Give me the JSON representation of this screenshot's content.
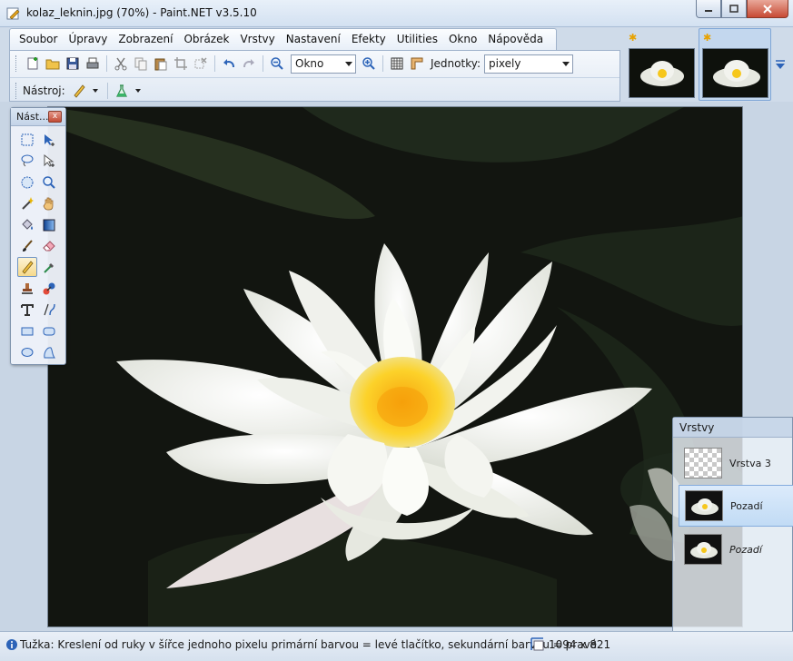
{
  "window": {
    "title": "kolaz_leknin.jpg (70%) - Paint.NET v3.5.10"
  },
  "menu": {
    "items": [
      "Soubor",
      "Úpravy",
      "Zobrazení",
      "Obrázek",
      "Vrstvy",
      "Nastavení",
      "Efekty",
      "Utilities",
      "Okno",
      "Nápověda"
    ]
  },
  "toolbar": {
    "zoom_value": "Okno",
    "units_label": "Jednotky:",
    "units_value": "pixely",
    "tool_label": "Nástroj:"
  },
  "tools_panel": {
    "title": "Nást...",
    "close_glyph": "x"
  },
  "layers_panel": {
    "title": "Vrstvy",
    "layers": [
      {
        "name": "Vrstva 3"
      },
      {
        "name": "Pozadí"
      },
      {
        "name": "Pozadí"
      }
    ]
  },
  "status": {
    "tool_hint": "Tužka: Kreslení od ruky v šířce jednoho pixelu primární barvou = levé tlačítko, sekundární barvou = pravé.",
    "image_size": "1094 x 821"
  },
  "colors": {
    "accent": "#3d6fb5",
    "flower_center": "#f6c71c",
    "canvas_bg": "#121510"
  }
}
